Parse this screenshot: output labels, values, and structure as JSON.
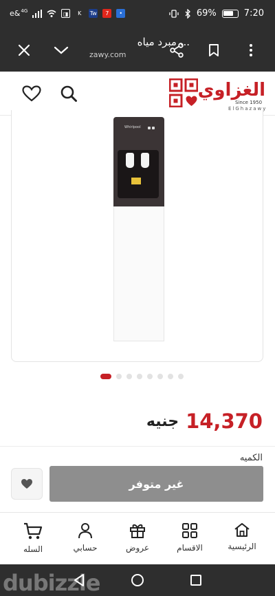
{
  "status_bar": {
    "left_text": "e&",
    "network": "4G",
    "battery": "69%",
    "time": "7:20"
  },
  "browser": {
    "page_title": "مبرد مياه ...",
    "url": "zawy.com"
  },
  "logo": {
    "name": "الغزاوي",
    "since": "Since 1950",
    "latin": "ElGhazawy"
  },
  "product_image": {
    "brand": "Whirlpool"
  },
  "carousel": {
    "dot_count": 8,
    "active_index": 0
  },
  "price": {
    "value": "14,370",
    "currency": "جنيه"
  },
  "quantity_label": "الكميه",
  "unavailable_label": "غير متوفر",
  "bottom_nav": [
    {
      "label": "الرئيسية",
      "icon": "home-icon"
    },
    {
      "label": "الاقسام",
      "icon": "grid-icon"
    },
    {
      "label": "عروض",
      "icon": "gift-icon"
    },
    {
      "label": "حسابي",
      "icon": "user-icon"
    },
    {
      "label": "السله",
      "icon": "cart-icon"
    }
  ],
  "watermark": "dubizzle",
  "colors": {
    "brand_red": "#c62026",
    "dark_bar": "#2e2e2e",
    "disabled_button": "#8e8e8e"
  }
}
